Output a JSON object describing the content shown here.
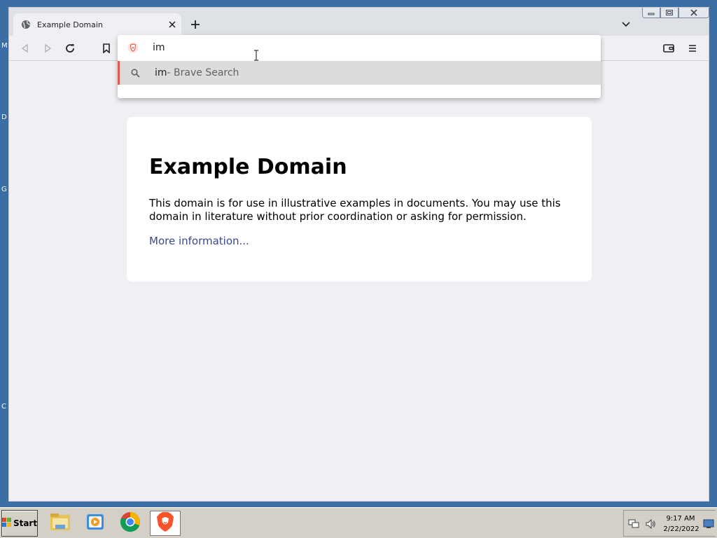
{
  "desktop": {
    "letters": [
      "M",
      "D",
      "G",
      "C"
    ]
  },
  "browser": {
    "tab": {
      "title": "Example Domain",
      "favicon": "globe-icon"
    },
    "omnibox": {
      "value": "im",
      "suggestion": {
        "query": "im",
        "description": " - Brave Search",
        "icon": "search-icon"
      }
    },
    "page": {
      "title": "Example Domain",
      "paragraph": "This domain is for use in illustrative examples in documents. You may use this domain in literature without prior coordination or asking for permission.",
      "link": "More information..."
    },
    "colors": {
      "accent": "#e25b4b",
      "link": "#38488f",
      "background": "#f0f0f4"
    }
  },
  "taskbar": {
    "start_label": "Start",
    "apps": [
      "file-explorer",
      "media-player",
      "chrome",
      "brave"
    ],
    "clock": {
      "time": "9:17 AM",
      "date": "2/22/2022"
    }
  }
}
